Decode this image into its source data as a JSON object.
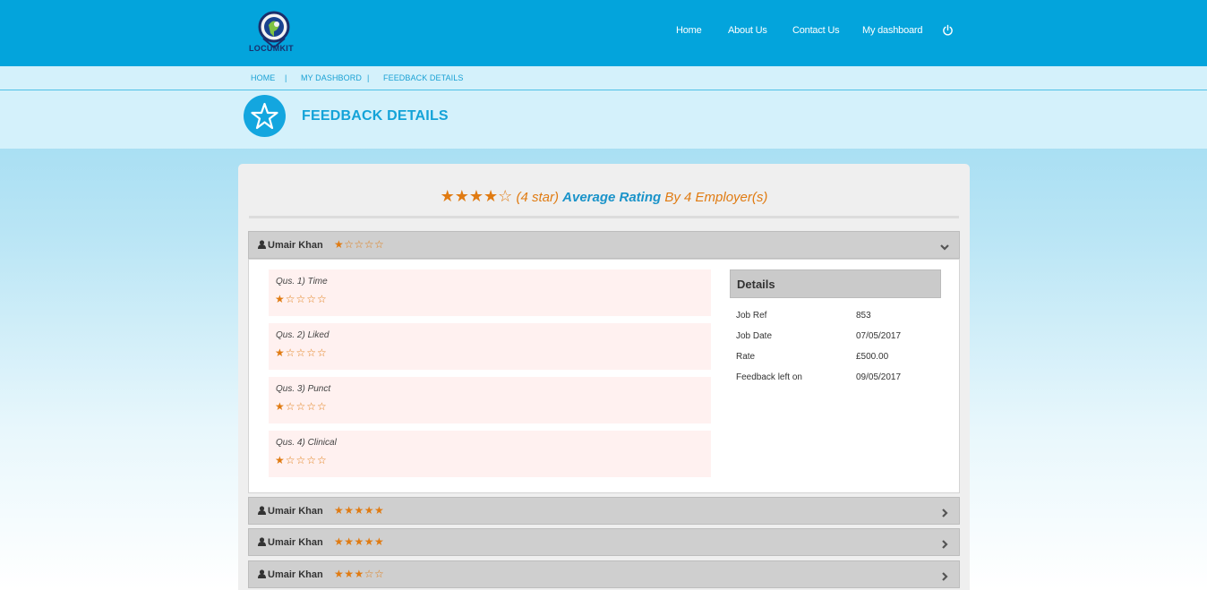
{
  "header": {
    "logo_text": "LOCUMKIT",
    "nav": [
      "Home",
      "About Us",
      "Contact Us",
      "My dashboard"
    ],
    "power_icon": "power-icon"
  },
  "breadcrumb": {
    "items": [
      "HOME",
      "MY DASHBORD",
      "FEEDBACK DETAILS"
    ],
    "separator": "|"
  },
  "page": {
    "title": "FEEDBACK DETAILS",
    "icon": "star-icon"
  },
  "summary": {
    "stars": "★★★★☆",
    "rating_text": "(4 star)",
    "average_label": "Average Rating",
    "by_text": "By 4 Employer(s)"
  },
  "feedbacks": [
    {
      "name": "Umair Khan",
      "stars": "★☆☆☆☆",
      "expanded": true,
      "questions": [
        {
          "label": "Qus. 1)  Time",
          "stars": "★☆☆☆☆"
        },
        {
          "label": "Qus. 2)  Liked",
          "stars": "★☆☆☆☆"
        },
        {
          "label": "Qus. 3)  Punct",
          "stars": "★☆☆☆☆"
        },
        {
          "label": "Qus. 4)  Clinical",
          "stars": "★☆☆☆☆"
        }
      ],
      "details": {
        "title": "Details",
        "rows": [
          {
            "key": "Job Ref",
            "value": "853"
          },
          {
            "key": "Job Date",
            "value": "07/05/2017"
          },
          {
            "key": "Rate",
            "value": "£500.00"
          },
          {
            "key": "Feedback left on",
            "value": "09/05/2017"
          }
        ]
      }
    },
    {
      "name": "Umair Khan",
      "stars": "★★★★★",
      "expanded": false
    },
    {
      "name": "Umair Khan",
      "stars": "★★★★★",
      "expanded": false
    },
    {
      "name": "Umair Khan",
      "stars": "★★★☆☆",
      "expanded": false
    }
  ],
  "colors": {
    "header_bg": "#03a4dc",
    "accent_orange": "#e07b12",
    "accent_blue": "#1a93c9"
  }
}
